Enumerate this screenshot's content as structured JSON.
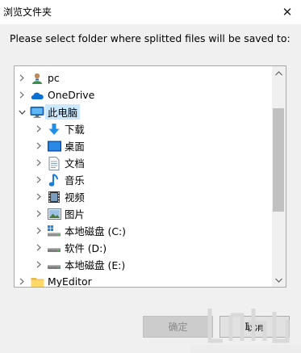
{
  "window": {
    "title": "浏览文件夹",
    "close_glyph": "✕"
  },
  "instruction": "Please select folder where splitted files will be saved to:",
  "tree": {
    "items": [
      {
        "label": "pc",
        "icon": "user-icon",
        "expanded": false,
        "level": 0
      },
      {
        "label": "OneDrive",
        "icon": "cloud-icon",
        "expanded": false,
        "level": 0
      },
      {
        "label": "此电脑",
        "icon": "monitor-icon",
        "expanded": true,
        "level": 0,
        "selected": true
      },
      {
        "label": "下载",
        "icon": "download-arrow-icon",
        "expanded": false,
        "level": 1
      },
      {
        "label": "桌面",
        "icon": "desktop-icon",
        "expanded": false,
        "level": 1
      },
      {
        "label": "文档",
        "icon": "document-icon",
        "expanded": false,
        "level": 1
      },
      {
        "label": "音乐",
        "icon": "music-note-icon",
        "expanded": false,
        "level": 1
      },
      {
        "label": "视频",
        "icon": "film-icon",
        "expanded": false,
        "level": 1
      },
      {
        "label": "图片",
        "icon": "picture-icon",
        "expanded": false,
        "level": 1
      },
      {
        "label": "本地磁盘 (C:)",
        "icon": "windows-drive-icon",
        "expanded": false,
        "level": 1
      },
      {
        "label": "软件 (D:)",
        "icon": "drive-icon",
        "expanded": false,
        "level": 1
      },
      {
        "label": "本地磁盘 (E:)",
        "icon": "drive-icon",
        "expanded": false,
        "level": 1
      },
      {
        "label": "MyEditor",
        "icon": "folder-icon",
        "expanded": false,
        "level": 0
      }
    ]
  },
  "buttons": {
    "ok_label": "确定",
    "cancel_label": "取消"
  },
  "colors": {
    "selection": "#cce8ff",
    "accent": "#0078d7",
    "folder": "#ffd86a"
  }
}
